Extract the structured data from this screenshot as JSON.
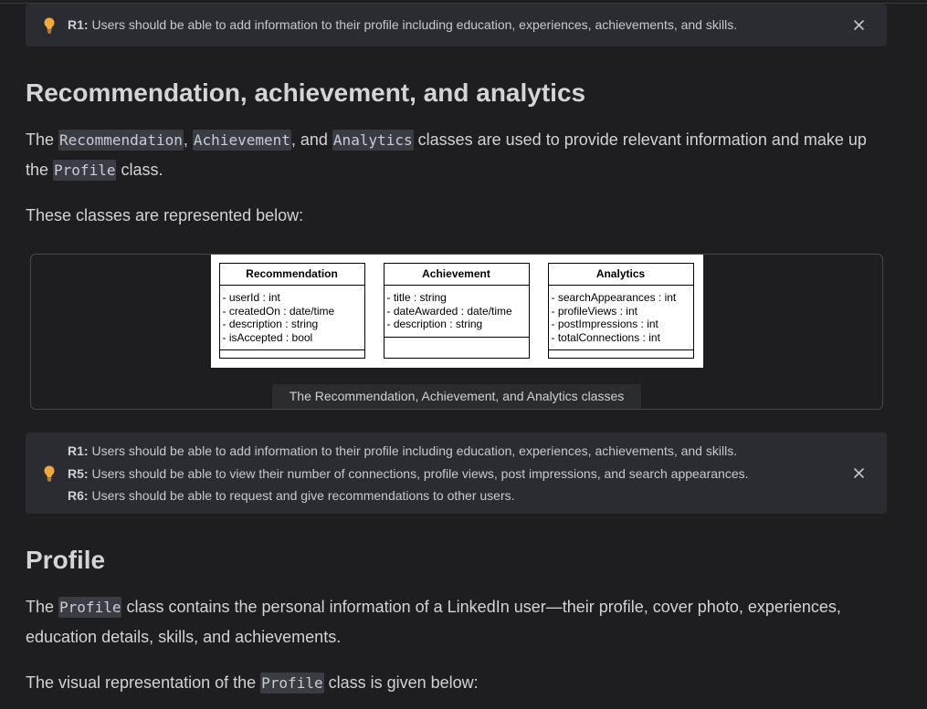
{
  "theme": {
    "page_background": "#1e1e21",
    "callout_background": "#2b2c31",
    "hint_icon_color": "#f2a93b",
    "inline_code_background": "#3a3c44",
    "figure_border": "#47484d"
  },
  "callouts": [
    {
      "icon": "lightbulb-icon",
      "close_icon": "close-icon",
      "items": [
        {
          "label": "R1:",
          "text": "Users should be able to add information to their profile including education, experiences, achievements, and skills."
        }
      ]
    },
    {
      "icon": "lightbulb-icon",
      "close_icon": "close-icon",
      "items": [
        {
          "label": "R1:",
          "text": "Users should be able to add information to their profile including education, experiences, achievements, and skills."
        },
        {
          "label": "R5:",
          "text": "Users should be able to view their number of connections, profile views, post impressions, and search appearances."
        },
        {
          "label": "R6:",
          "text": "Users should be able to request and give recommendations to other users."
        }
      ]
    }
  ],
  "section_analytics": {
    "heading": "Recommendation, achievement, and analytics",
    "intro": [
      {
        "text": "The "
      },
      {
        "code": "Recommendation"
      },
      {
        "text": ", "
      },
      {
        "code": "Achievement"
      },
      {
        "text": ", and "
      },
      {
        "code": "Analytics"
      },
      {
        "text": " classes are used to provide relevant information and make up the "
      },
      {
        "code": "Profile"
      },
      {
        "text": " class."
      }
    ],
    "lead_in": "These classes are represented below:",
    "figure": {
      "classes": [
        {
          "name": "Recommendation",
          "attributes": [
            "- userId : int",
            "- createdOn : date/time",
            "- description : string",
            "- isAccepted : bool"
          ]
        },
        {
          "name": "Achievement",
          "attributes": [
            "- title : string",
            "- dateAwarded : date/time",
            "- description : string"
          ]
        },
        {
          "name": "Analytics",
          "attributes": [
            "- searchAppearances : int",
            "- profileViews : int",
            "- postImpressions : int",
            "- totalConnections : int"
          ]
        }
      ],
      "caption": "The Recommendation, Achievement, and Analytics classes"
    }
  },
  "section_profile": {
    "heading": "Profile",
    "intro": [
      {
        "text": "The "
      },
      {
        "code": "Profile"
      },
      {
        "text": " class contains the personal information of a LinkedIn user—their profile, cover photo, experiences, education details, skills, and achievements."
      }
    ],
    "lead_in": [
      {
        "text": "The visual representation of the "
      },
      {
        "code": "Profile"
      },
      {
        "text": " class is given below:"
      }
    ]
  }
}
